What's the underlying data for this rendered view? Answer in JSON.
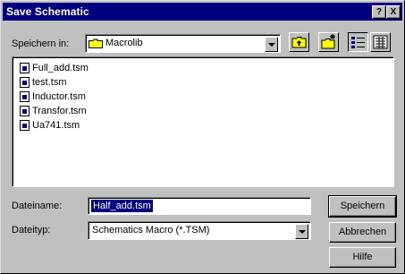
{
  "window": {
    "title": "Save Schematic",
    "help_button": "?",
    "close_button": "X"
  },
  "location": {
    "label": "Speichern in:",
    "value": "Macrolib"
  },
  "files": [
    {
      "name": "Full_add.tsm"
    },
    {
      "name": "test.tsm"
    },
    {
      "name": "Inductor.tsm"
    },
    {
      "name": "Transfor.tsm"
    },
    {
      "name": "Ua741.tsm"
    }
  ],
  "filename": {
    "label": "Dateiname:",
    "value": "Half_add.tsm"
  },
  "filetype": {
    "label": "Dateityp:",
    "value": "Schematics Macro (*.TSM)"
  },
  "buttons": {
    "save": "Speichern",
    "cancel": "Abbrechen",
    "help": "Hilfe"
  },
  "colors": {
    "titlebar": "#000080",
    "face": "#c0c0c0",
    "folder": "#ffff00",
    "selection": "#000080"
  }
}
